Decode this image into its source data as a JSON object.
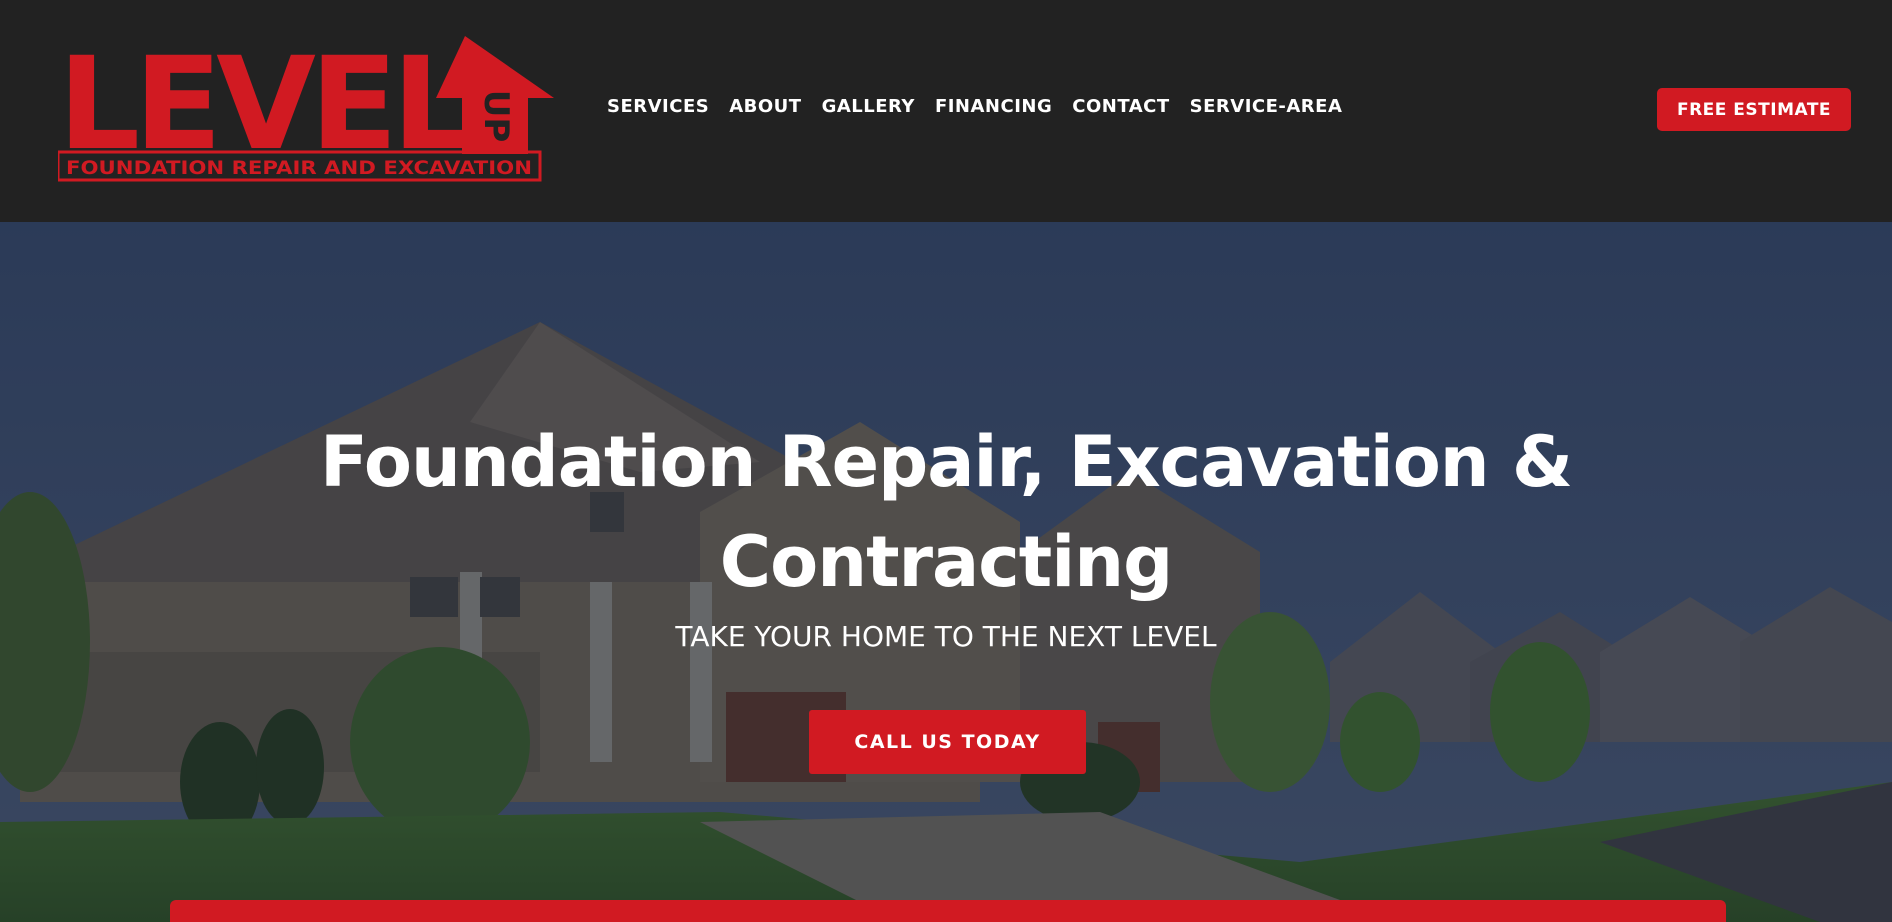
{
  "brand": {
    "logo_word": "LEVEL",
    "logo_up": "UP",
    "logo_tagline": "FOUNDATION REPAIR AND EXCAVATION"
  },
  "nav": {
    "items": [
      {
        "label": "SERVICES"
      },
      {
        "label": "ABOUT"
      },
      {
        "label": "GALLERY"
      },
      {
        "label": "FINANCING"
      },
      {
        "label": "CONTACT"
      },
      {
        "label": "SERVICE-AREA"
      }
    ],
    "cta_label": "FREE ESTIMATE"
  },
  "hero": {
    "title": "Foundation Repair, Excavation & Contracting",
    "subtitle": "TAKE YOUR HOME TO THE NEXT LEVEL",
    "cta_label": "CALL US TODAY"
  },
  "colors": {
    "header_bg": "#222222",
    "brand_red": "#d11a22",
    "text_light": "#ffffff"
  }
}
